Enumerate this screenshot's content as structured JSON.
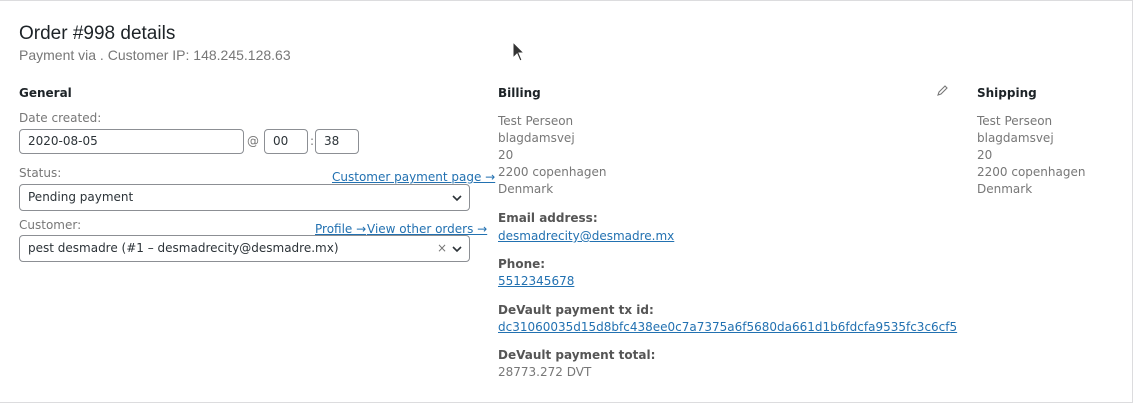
{
  "header": {
    "title": "Order #998 details",
    "subtitle": "Payment via . Customer IP: 148.245.128.63"
  },
  "general": {
    "heading": "General",
    "date_label": "Date created:",
    "date_value": "2020-08-05",
    "at_sep": "@",
    "hour": "00",
    "colon_sep": ":",
    "minute": "38",
    "status_label": "Status:",
    "customer_payment_link": "Customer payment page →",
    "status_value": "Pending payment",
    "customer_label": "Customer:",
    "profile_link": "Profile →",
    "other_orders_link": "View other orders →",
    "customer_value": "pest desmadre (#1 – desmadrecity@desmadre.mx)",
    "clear_symbol": "×"
  },
  "billing": {
    "heading": "Billing",
    "address": [
      "Test Perseon",
      "blagdamsvej",
      "20",
      "2200 copenhagen",
      "Denmark"
    ],
    "email_label": "Email address:",
    "email_value": "desmadrecity@desmadre.mx",
    "phone_label": "Phone:",
    "phone_value": "5512345678",
    "tx_label": "DeVault payment tx id:",
    "tx_value": "dc31060035d15d8bfc438ee0c7a7375a6f5680da661d1b6fdcfa9535fc3c6cf5",
    "total_label": "DeVault payment total:",
    "total_value": "28773.272 DVT",
    "edit_icon": "pencil-icon"
  },
  "shipping": {
    "heading": "Shipping",
    "address": [
      "Test Perseon",
      "blagdamsvej",
      "20",
      "2200 copenhagen",
      "Denmark"
    ]
  },
  "colors": {
    "link": "#2271b1",
    "muted": "#777777",
    "heading": "#1d2327"
  }
}
